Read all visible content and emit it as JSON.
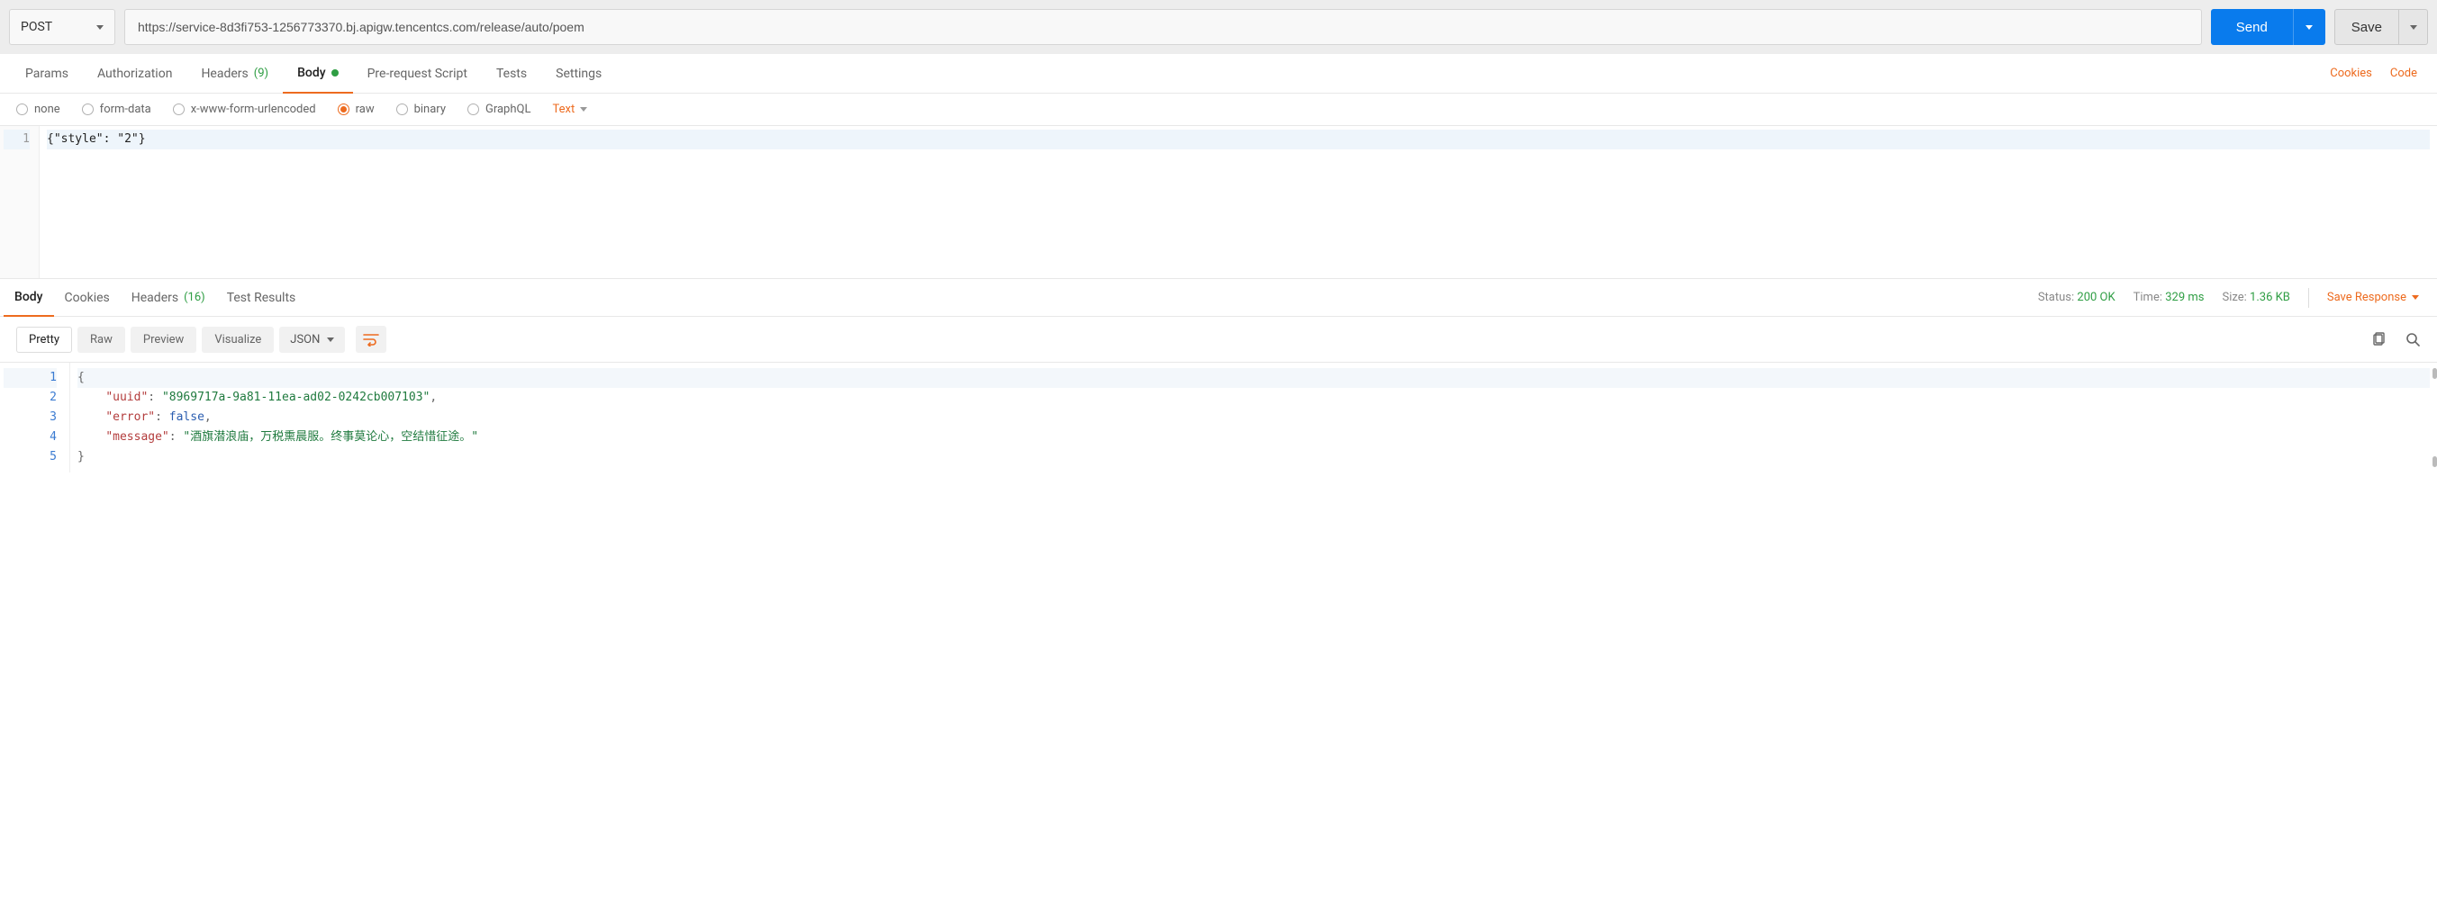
{
  "request": {
    "method": "POST",
    "url": "https://service-8d3fi753-1256773370.bj.apigw.tencentcs.com/release/auto/poem",
    "send_label": "Send",
    "save_label": "Save"
  },
  "tabs": {
    "params": "Params",
    "authorization": "Authorization",
    "headers": "Headers",
    "headers_count": "(9)",
    "body": "Body",
    "prerequest": "Pre-request Script",
    "tests": "Tests",
    "settings": "Settings",
    "cookies_link": "Cookies",
    "code_link": "Code"
  },
  "body_types": {
    "none": "none",
    "formdata": "form-data",
    "urlencoded": "x-www-form-urlencoded",
    "raw": "raw",
    "binary": "binary",
    "graphql": "GraphQL",
    "text_type": "Text"
  },
  "request_body": {
    "line1_num": "1",
    "line1_text": "{\"style\": \"2\"}"
  },
  "response_tabs": {
    "body": "Body",
    "cookies": "Cookies",
    "headers": "Headers",
    "headers_count": "(16)",
    "test_results": "Test Results"
  },
  "status": {
    "status_label": "Status:",
    "status_value": "200 OK",
    "time_label": "Time:",
    "time_value": "329 ms",
    "size_label": "Size:",
    "size_value": "1.36 KB",
    "save_response": "Save Response"
  },
  "format": {
    "pretty": "Pretty",
    "raw": "Raw",
    "preview": "Preview",
    "visualize": "Visualize",
    "json": "JSON"
  },
  "response_body": {
    "n1": "1",
    "n2": "2",
    "n3": "3",
    "n4": "4",
    "n5": "5",
    "l1": "{",
    "l2_key": "\"uuid\"",
    "l2_sep": ": ",
    "l2_val": "\"8969717a-9a81-11ea-ad02-0242cb007103\"",
    "l2_end": ",",
    "l3_key": "\"error\"",
    "l3_sep": ": ",
    "l3_val": "false",
    "l3_end": ",",
    "l4_key": "\"message\"",
    "l4_sep": ": ",
    "l4_val": "\"酒旗潜浪庙，万税熏晨服。终事莫论心，空结惜征途。\"",
    "l5": "}"
  }
}
